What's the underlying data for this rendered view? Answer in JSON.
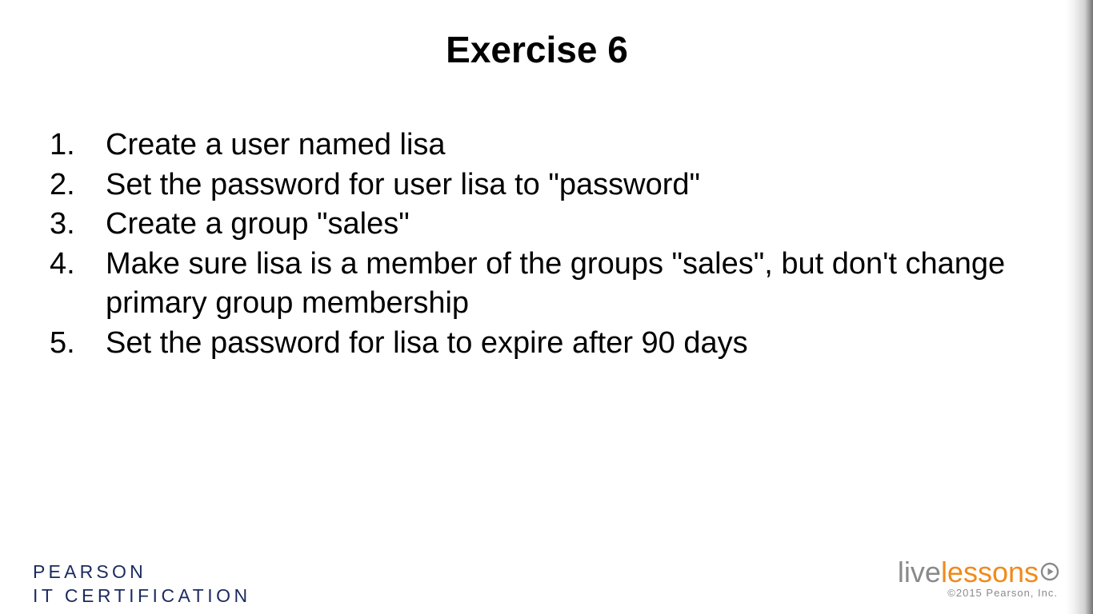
{
  "slide": {
    "title": "Exercise 6",
    "items": [
      {
        "number": "1.",
        "text": "Create a user named lisa"
      },
      {
        "number": "2.",
        "text": "Set the password for user lisa to \"password\""
      },
      {
        "number": "3.",
        "text": "Create a group \"sales\""
      },
      {
        "number": "4.",
        "text": "Make sure lisa is a member of the groups \"sales\", but don't change primary group membership"
      },
      {
        "number": "5.",
        "text": "Set the password for lisa to expire after 90 days"
      }
    ]
  },
  "footer": {
    "pearson_line1": "PEARSON",
    "pearson_line2": "IT CERTIFICATION",
    "brand_live": "live",
    "brand_lessons": "lessons",
    "brand_icon": "play-circle-icon",
    "copyright": "©2015 Pearson, Inc."
  },
  "colors": {
    "pearson_navy": "#1b2a5e",
    "lessons_orange": "#f08a1c",
    "live_gray": "#8a8a8a"
  }
}
